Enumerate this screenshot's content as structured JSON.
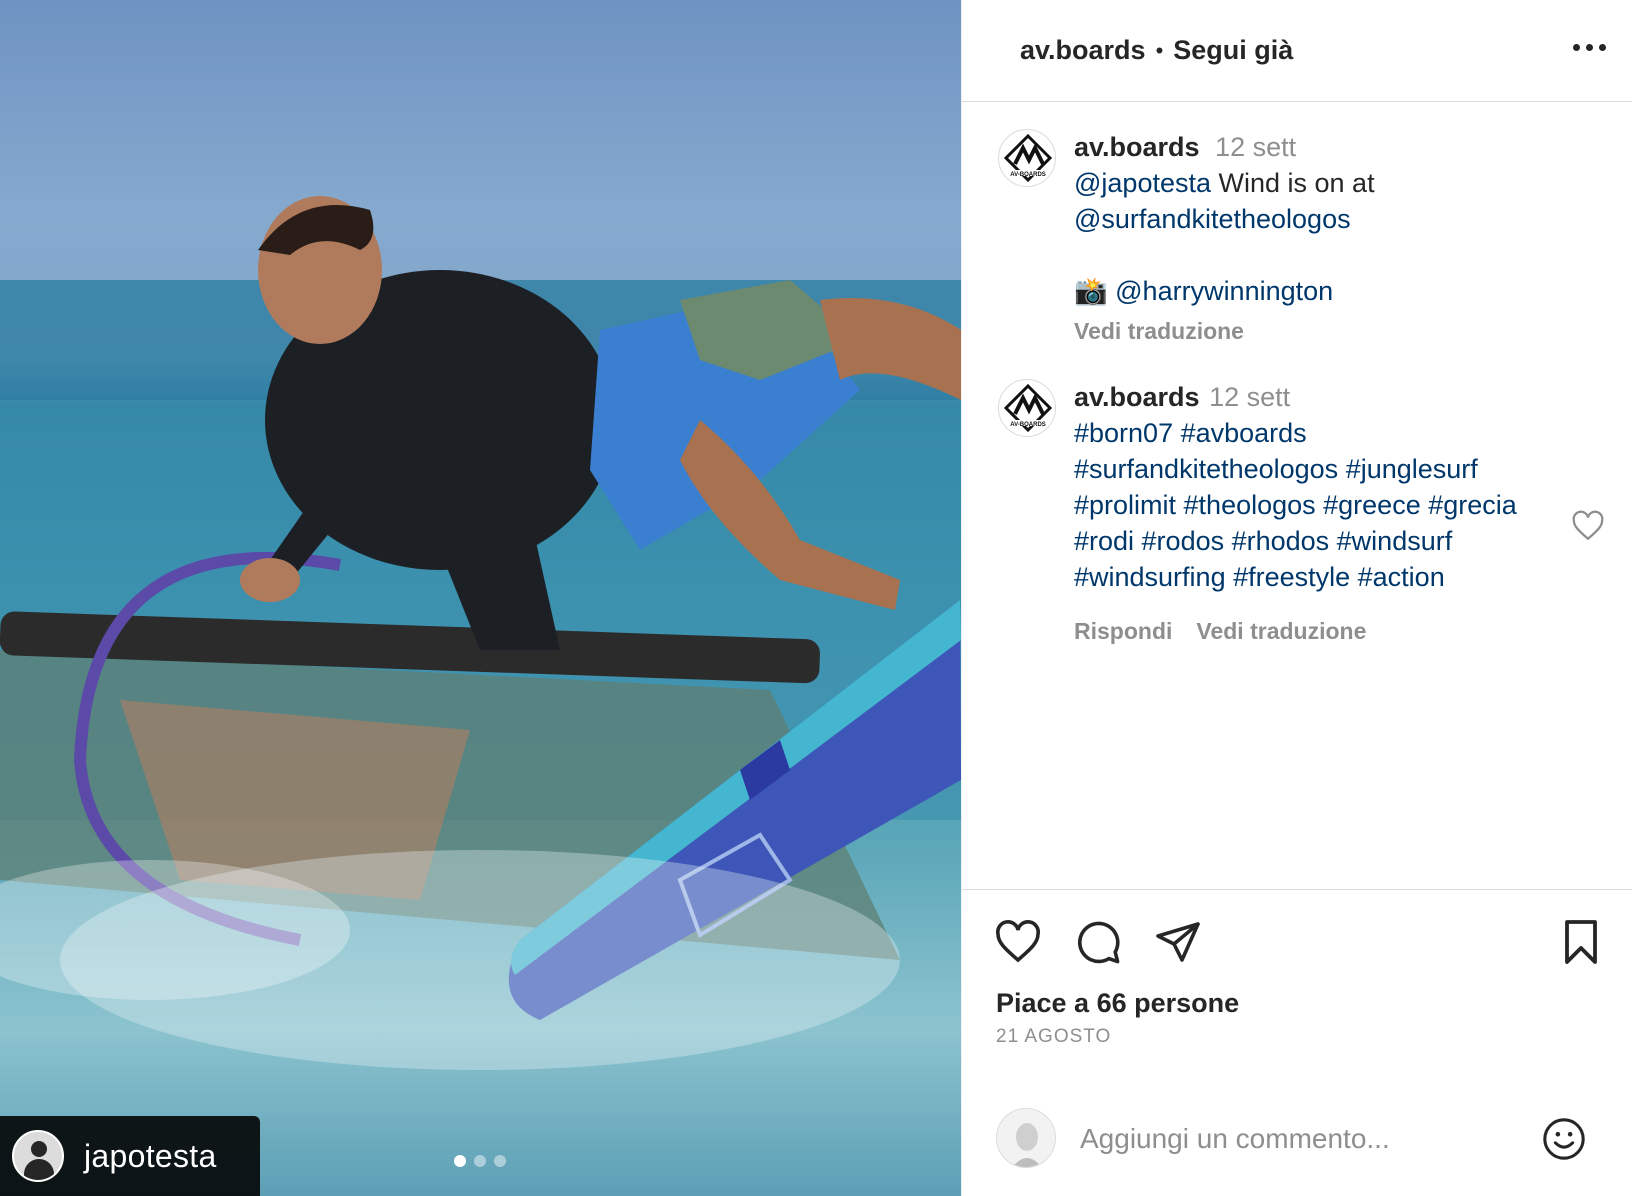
{
  "media": {
    "tagged_user": "japotesta",
    "carousel": {
      "count": 3,
      "active_index": 0
    }
  },
  "header": {
    "username": "av.boards",
    "separator": "•",
    "follow_status": "Segui già",
    "more_icon": "more-horizontal-icon"
  },
  "caption": {
    "username": "av.boards",
    "time": "12 sett",
    "mention_1": "@japotesta",
    "text_1": " Wind is on at ",
    "mention_2": "@surfandkitetheologos",
    "camera_emoji": "📸",
    "mention_3": "@harrywinnington",
    "translate": "Vedi traduzione"
  },
  "comment": {
    "username": "av.boards",
    "time": "12 sett",
    "hashtags": "#born07 #avboards #surfandkitetheologos #junglesurf #prolimit #theologos #greece #grecia #rodi #rodos #rhodos #windsurf #windsurfing #freestyle #action",
    "reply": "Rispondi",
    "translate": "Vedi traduzione"
  },
  "actions": {
    "like_icon": "heart-icon",
    "comment_icon": "comment-icon",
    "share_icon": "share-icon",
    "save_icon": "bookmark-icon",
    "likes_text": "Piace a 66 persone",
    "date": "21 AGOSTO"
  },
  "add_comment": {
    "placeholder": "Aggiungi un commento...",
    "emoji_icon": "emoji-icon"
  },
  "colors": {
    "link": "#00376b",
    "text": "#262626",
    "secondary": "#8e8e8e",
    "divider": "#dbdbdb"
  }
}
